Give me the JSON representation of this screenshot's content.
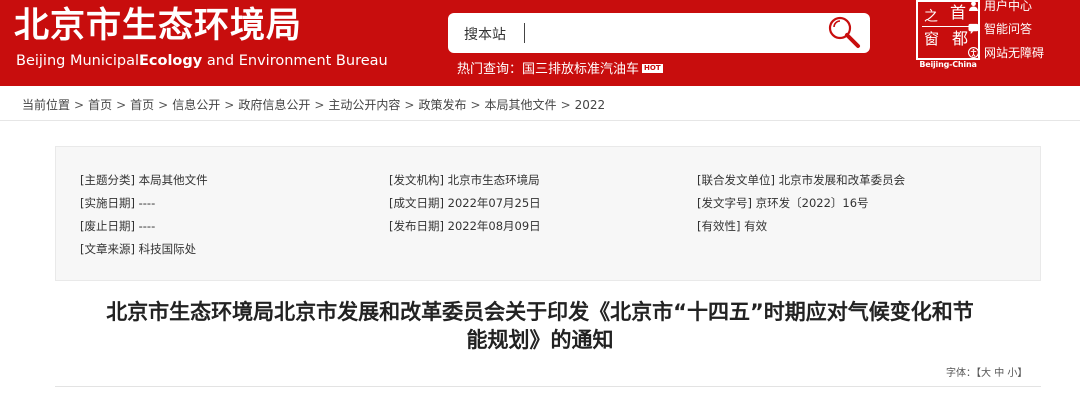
{
  "header": {
    "logo_cn": "北京市生态环境局",
    "logo_en_parts": [
      "Beijing Municipal",
      "Ecology",
      "and Environment Bureau"
    ],
    "search_placeholder": "搜本站",
    "hot_label": "热门查询：",
    "hot_link": "国三排放标准汽油车",
    "hot_badge": "HOT",
    "emblem_chars": [
      "之",
      "首",
      "窗",
      "都"
    ],
    "emblem_caption": "Beijing-China",
    "links": [
      "用户中心",
      "智能问答",
      "网站无障碍"
    ],
    "brand_color": "#c80d0d"
  },
  "breadcrumb": {
    "label": "当前位置",
    "items": [
      "首页",
      "首页",
      "信息公开",
      "政府信息公开",
      "主动公开内容",
      "政策发布",
      "本局其他文件",
      "2022"
    ]
  },
  "info": {
    "topic": "[主题分类] 本局其他文件",
    "issuer": "[发文机构] 北京市生态环境局",
    "joint": "[联合发文单位] 北京市发展和改革委员会",
    "effective": "[实施日期] ----",
    "created": "[成文日期] 2022年07月25日",
    "doc_no": "[发文字号] 京环发〔2022〕16号",
    "repeal": "[废止日期] ----",
    "published": "[发布日期] 2022年08月09日",
    "validity": "[有效性] 有效",
    "source": "[文章来源] 科技国际处"
  },
  "article": {
    "title_line1": "北京市生态环境局北京市发展和改革委员会关于印发《北京市“十四五”时期应对气候变化和节",
    "title_line2": "能规划》的通知",
    "font_label": "字体：【",
    "font_large": "大",
    "font_medium": "中",
    "font_small": "小",
    "font_end": "】"
  }
}
